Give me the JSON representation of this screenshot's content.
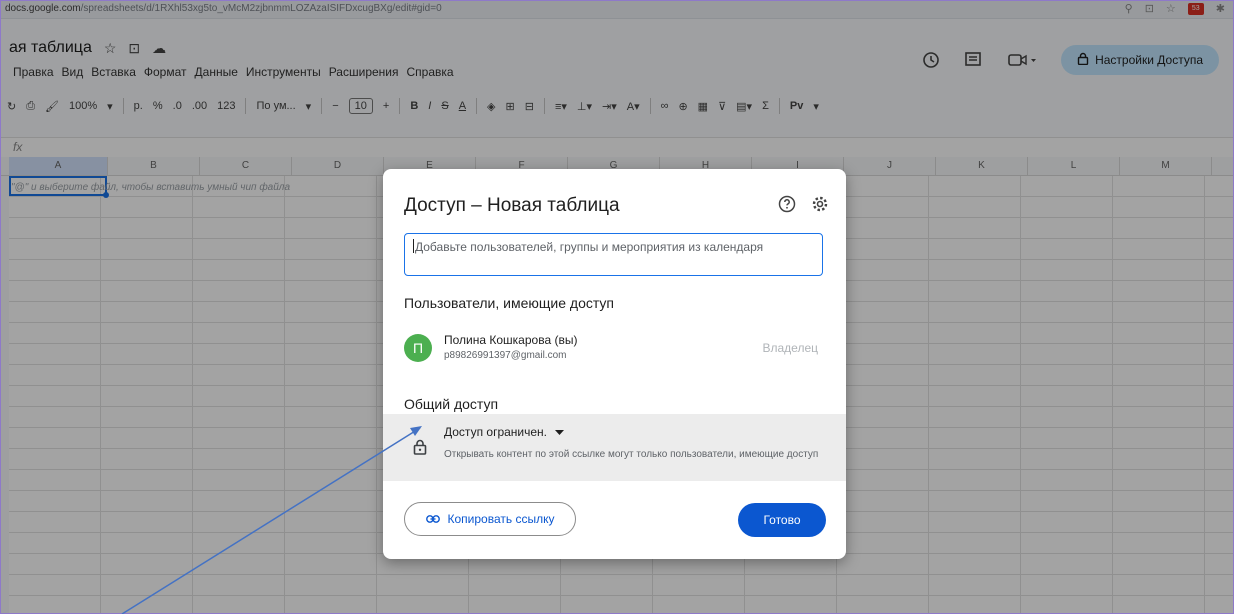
{
  "browser": {
    "url_host": "docs.google.com",
    "url_path": "/spreadsheets/d/1RXhl53xg5to_vMcM2zjbnmmLOZAzaISIFDxcugBXg/edit#gid=0",
    "ext_badge": "53"
  },
  "doc": {
    "title": "ая таблица",
    "menu": [
      "Правка",
      "Вид",
      "Вставка",
      "Формат",
      "Данные",
      "Инструменты",
      "Расширения",
      "Справка"
    ]
  },
  "header": {
    "share_label": "Настройки Доступа"
  },
  "toolbar": {
    "zoom": "100%",
    "currency": "р.",
    "percent": "%",
    "dec_less": ".0",
    "dec_more": ".00",
    "num_format": "123",
    "font": "По ум...",
    "font_size": "10",
    "minus": "−",
    "plus": "+",
    "bold": "B",
    "italic": "I",
    "strike": "S",
    "text_color": "A",
    "sum": "Σ",
    "input_tools": "Pv"
  },
  "grid": {
    "formula_icon": "fx",
    "columns": [
      "A",
      "B",
      "C",
      "D",
      "E",
      "F",
      "G",
      "H",
      "I",
      "J",
      "K",
      "L",
      "M"
    ],
    "hint": "\"@\" и выберите файл, чтобы вставить умный чип файла"
  },
  "dialog": {
    "title": "Доступ – Новая таблица",
    "add_placeholder": "Добавьте пользователей, группы и мероприятия из календаря",
    "people_title": "Пользователи, имеющие доступ",
    "user": {
      "initial": "П",
      "name": "Полина Кошкарова (вы)",
      "email": "p89826991397@gmail.com",
      "role": "Владелец"
    },
    "general_title": "Общий доступ",
    "access_level": "Доступ ограничен.",
    "access_desc": "Открывать контент по этой ссылке могут только пользователи, имеющие доступ",
    "copy_link": "Копировать ссылку",
    "done": "Готово"
  },
  "colors": {
    "primary": "#0b57d0",
    "share_bg": "#c2e7ff",
    "avatar": "#4caf50",
    "arrow": "#4472c4"
  }
}
